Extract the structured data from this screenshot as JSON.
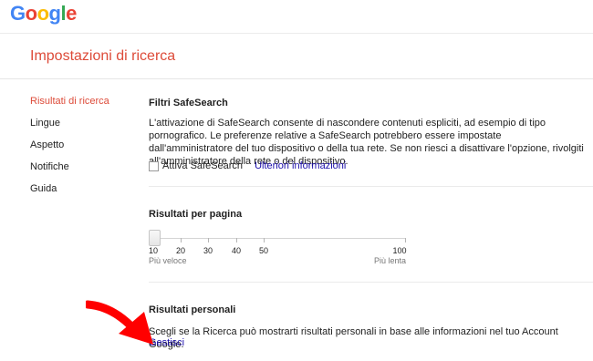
{
  "header": {
    "logo_letters": [
      {
        "char": "G",
        "color": "#4285f4"
      },
      {
        "char": "o",
        "color": "#ea4335"
      },
      {
        "char": "o",
        "color": "#fbbc05"
      },
      {
        "char": "g",
        "color": "#4285f4"
      },
      {
        "char": "l",
        "color": "#34a853"
      },
      {
        "char": "e",
        "color": "#ea4335"
      }
    ]
  },
  "page": {
    "title": "Impostazioni di ricerca"
  },
  "sidebar": {
    "items": [
      {
        "label": "Risultati di ricerca",
        "active": true
      },
      {
        "label": "Lingue",
        "active": false
      },
      {
        "label": "Aspetto",
        "active": false
      },
      {
        "label": "Notifiche",
        "active": false
      },
      {
        "label": "Guida",
        "active": false
      }
    ]
  },
  "safesearch": {
    "title": "Filtri SafeSearch",
    "description": "L'attivazione di SafeSearch consente di nascondere contenuti espliciti, ad esempio di tipo pornografico. Le preferenze relative a SafeSearch potrebbero essere impostate dall'amministratore del tuo dispositivo o della tua rete. Se non riesci a disattivare l'opzione, rivolgiti all'amministratore della rete o del dispositivo.",
    "checkbox_label": "Attiva SafeSearch",
    "checkbox_checked": false,
    "more_info_link": "Ulteriori informazioni"
  },
  "results_per_page": {
    "title": "Risultati per pagina",
    "ticks": [
      "10",
      "20",
      "30",
      "40",
      "50",
      "100"
    ],
    "selected_value": 10,
    "min_label": "Più veloce",
    "max_label": "Più lenta"
  },
  "personal_results": {
    "title": "Risultati personali",
    "description": "Scegli se la Ricerca può mostrarti risultati personali in base alle informazioni nel tuo Account Google.",
    "manage_link": "Gestisci"
  },
  "colors": {
    "accent": "#dd4b39",
    "link": "#1a0dab",
    "annotation_arrow": "#ff0000"
  }
}
